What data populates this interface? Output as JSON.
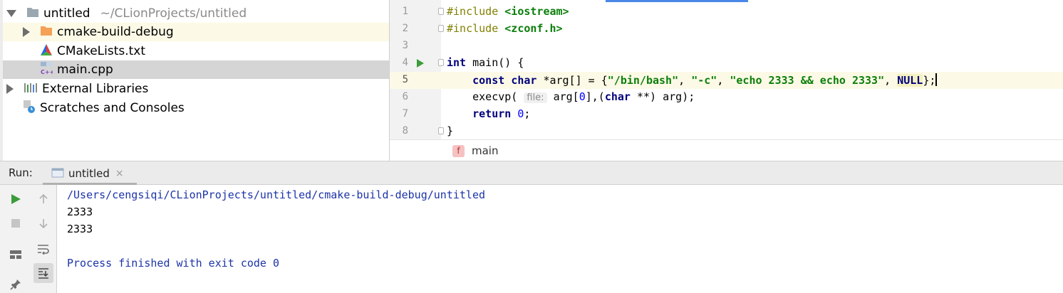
{
  "project": {
    "root_name": "untitled",
    "root_path": "~/CLionProjects/untitled",
    "items": [
      {
        "name": "cmake-build-debug"
      },
      {
        "name": "CMakeLists.txt"
      },
      {
        "name": "main.cpp"
      }
    ],
    "external_libraries": "External Libraries",
    "scratches": "Scratches and Consoles"
  },
  "editor": {
    "line_numbers": [
      "1",
      "2",
      "3",
      "4",
      "5",
      "6",
      "7",
      "8"
    ],
    "code": {
      "l1_pp": "#include ",
      "l1_inc": "<iostream>",
      "l2_pp": "#include ",
      "l2_inc": "<zconf.h>",
      "l4_kw": "int",
      "l4_rest": " main() {",
      "l5_indent": "    ",
      "l5_kw1": "const",
      "l5_sp": " ",
      "l5_kw2": "char",
      "l5_a": " *arg[] = {",
      "l5_s1": "\"/bin/bash\"",
      "l5_c1": ", ",
      "l5_s2": "\"-c\"",
      "l5_c2": ", ",
      "l5_s3": "\"echo 2333 && echo 2333\"",
      "l5_c3": ", ",
      "l5_null": "NULL",
      "l5_end": "};",
      "l6_a": "    execvp( ",
      "l6_hint": "file:",
      "l6_b": " arg[",
      "l6_num": "0",
      "l6_c": "],(",
      "l6_kw": "char",
      "l6_d": " **) arg);",
      "l7_indent": "    ",
      "l7_kw": "return",
      "l7_sp": " ",
      "l7_num": "0",
      "l7_end": ";",
      "l8": "}"
    },
    "breadcrumb_badge": "f",
    "breadcrumb": "main"
  },
  "run": {
    "label": "Run:",
    "tab": "untitled",
    "tab_close": "×",
    "output": [
      "/Users/cengsiqi/CLionProjects/untitled/cmake-build-debug/untitled",
      "2333",
      "2333",
      "",
      "Process finished with exit code 0"
    ]
  },
  "colors": {
    "keyword": "#00007d",
    "string": "#0b7f0b",
    "number": "#0000ff",
    "preprocessor": "#808000",
    "console_blue": "#1c34a8",
    "run_green": "#3c9c3c",
    "current_line": "#fcfae6",
    "selection": "#d5d5d5"
  }
}
